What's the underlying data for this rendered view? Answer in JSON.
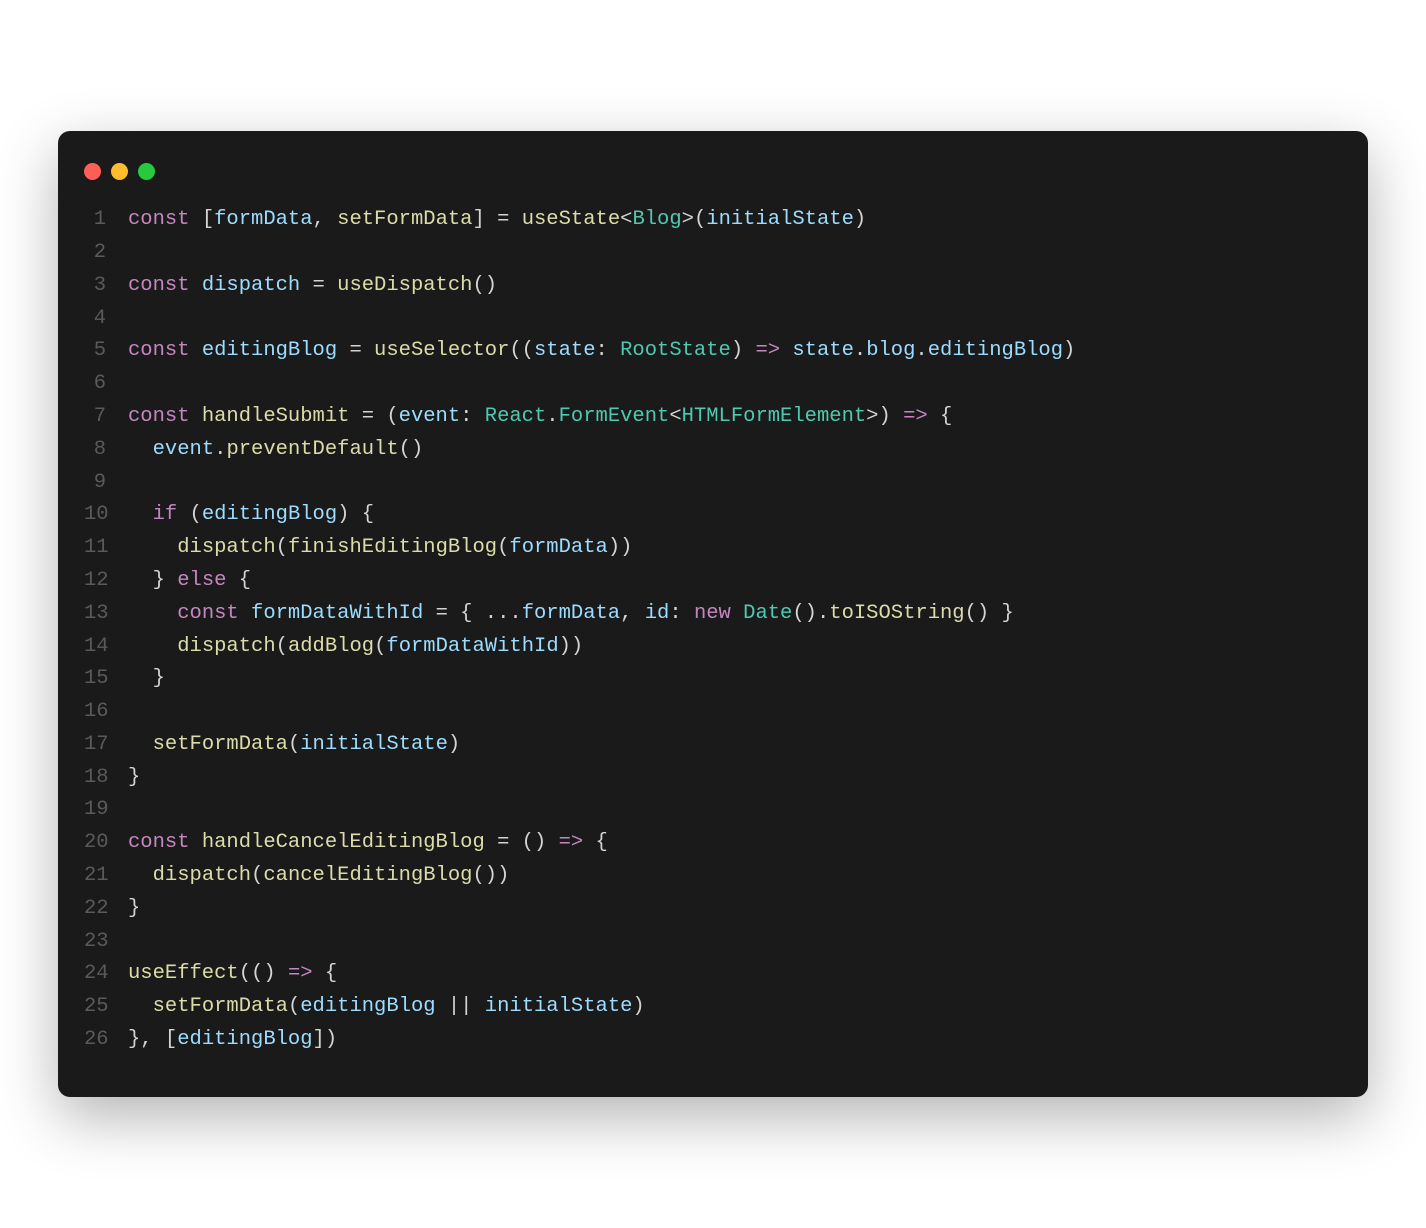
{
  "window": {
    "traffic_lights": [
      "red",
      "yellow",
      "green"
    ]
  },
  "code": {
    "lines": [
      {
        "n": 1,
        "tokens": [
          {
            "t": "const ",
            "c": "kw"
          },
          {
            "t": "[",
            "c": "punct"
          },
          {
            "t": "formData",
            "c": "id"
          },
          {
            "t": ", ",
            "c": "punct"
          },
          {
            "t": "setFormData",
            "c": "fn"
          },
          {
            "t": "] = ",
            "c": "punct"
          },
          {
            "t": "useState",
            "c": "fn"
          },
          {
            "t": "<",
            "c": "punct"
          },
          {
            "t": "Blog",
            "c": "type"
          },
          {
            "t": ">(",
            "c": "punct"
          },
          {
            "t": "initialState",
            "c": "id"
          },
          {
            "t": ")",
            "c": "punct"
          }
        ]
      },
      {
        "n": 2,
        "tokens": []
      },
      {
        "n": 3,
        "tokens": [
          {
            "t": "const ",
            "c": "kw"
          },
          {
            "t": "dispatch",
            "c": "id"
          },
          {
            "t": " = ",
            "c": "punct"
          },
          {
            "t": "useDispatch",
            "c": "fn"
          },
          {
            "t": "()",
            "c": "punct"
          }
        ]
      },
      {
        "n": 4,
        "tokens": []
      },
      {
        "n": 5,
        "tokens": [
          {
            "t": "const ",
            "c": "kw"
          },
          {
            "t": "editingBlog",
            "c": "id"
          },
          {
            "t": " = ",
            "c": "punct"
          },
          {
            "t": "useSelector",
            "c": "fn"
          },
          {
            "t": "((",
            "c": "punct"
          },
          {
            "t": "state",
            "c": "id"
          },
          {
            "t": ": ",
            "c": "punct"
          },
          {
            "t": "RootState",
            "c": "type"
          },
          {
            "t": ") ",
            "c": "punct"
          },
          {
            "t": "=>",
            "c": "kw"
          },
          {
            "t": " ",
            "c": "punct"
          },
          {
            "t": "state",
            "c": "id"
          },
          {
            "t": ".",
            "c": "punct"
          },
          {
            "t": "blog",
            "c": "prop"
          },
          {
            "t": ".",
            "c": "punct"
          },
          {
            "t": "editingBlog",
            "c": "prop"
          },
          {
            "t": ")",
            "c": "punct"
          }
        ]
      },
      {
        "n": 6,
        "tokens": []
      },
      {
        "n": 7,
        "tokens": [
          {
            "t": "const ",
            "c": "kw"
          },
          {
            "t": "handleSubmit",
            "c": "fn"
          },
          {
            "t": " = (",
            "c": "punct"
          },
          {
            "t": "event",
            "c": "id"
          },
          {
            "t": ": ",
            "c": "punct"
          },
          {
            "t": "React",
            "c": "type"
          },
          {
            "t": ".",
            "c": "punct"
          },
          {
            "t": "FormEvent",
            "c": "type"
          },
          {
            "t": "<",
            "c": "punct"
          },
          {
            "t": "HTMLFormElement",
            "c": "type"
          },
          {
            "t": ">) ",
            "c": "punct"
          },
          {
            "t": "=>",
            "c": "kw"
          },
          {
            "t": " {",
            "c": "punct"
          }
        ]
      },
      {
        "n": 8,
        "tokens": [
          {
            "t": "  ",
            "c": "punct"
          },
          {
            "t": "event",
            "c": "id"
          },
          {
            "t": ".",
            "c": "punct"
          },
          {
            "t": "preventDefault",
            "c": "fn"
          },
          {
            "t": "()",
            "c": "punct"
          }
        ]
      },
      {
        "n": 9,
        "tokens": []
      },
      {
        "n": 10,
        "tokens": [
          {
            "t": "  ",
            "c": "punct"
          },
          {
            "t": "if",
            "c": "kw"
          },
          {
            "t": " (",
            "c": "punct"
          },
          {
            "t": "editingBlog",
            "c": "id"
          },
          {
            "t": ") {",
            "c": "punct"
          }
        ]
      },
      {
        "n": 11,
        "tokens": [
          {
            "t": "    ",
            "c": "punct"
          },
          {
            "t": "dispatch",
            "c": "fn"
          },
          {
            "t": "(",
            "c": "punct"
          },
          {
            "t": "finishEditingBlog",
            "c": "fn"
          },
          {
            "t": "(",
            "c": "punct"
          },
          {
            "t": "formData",
            "c": "id"
          },
          {
            "t": "))",
            "c": "punct"
          }
        ]
      },
      {
        "n": 12,
        "tokens": [
          {
            "t": "  } ",
            "c": "punct"
          },
          {
            "t": "else",
            "c": "kw"
          },
          {
            "t": " {",
            "c": "punct"
          }
        ]
      },
      {
        "n": 13,
        "tokens": [
          {
            "t": "    ",
            "c": "punct"
          },
          {
            "t": "const ",
            "c": "kw"
          },
          {
            "t": "formDataWithId",
            "c": "id"
          },
          {
            "t": " = { ...",
            "c": "punct"
          },
          {
            "t": "formData",
            "c": "id"
          },
          {
            "t": ", ",
            "c": "punct"
          },
          {
            "t": "id",
            "c": "prop"
          },
          {
            "t": ": ",
            "c": "punct"
          },
          {
            "t": "new ",
            "c": "kw"
          },
          {
            "t": "Date",
            "c": "type"
          },
          {
            "t": "().",
            "c": "punct"
          },
          {
            "t": "toISOString",
            "c": "fn"
          },
          {
            "t": "() }",
            "c": "punct"
          }
        ]
      },
      {
        "n": 14,
        "tokens": [
          {
            "t": "    ",
            "c": "punct"
          },
          {
            "t": "dispatch",
            "c": "fn"
          },
          {
            "t": "(",
            "c": "punct"
          },
          {
            "t": "addBlog",
            "c": "fn"
          },
          {
            "t": "(",
            "c": "punct"
          },
          {
            "t": "formDataWithId",
            "c": "id"
          },
          {
            "t": "))",
            "c": "punct"
          }
        ]
      },
      {
        "n": 15,
        "tokens": [
          {
            "t": "  }",
            "c": "punct"
          }
        ]
      },
      {
        "n": 16,
        "tokens": []
      },
      {
        "n": 17,
        "tokens": [
          {
            "t": "  ",
            "c": "punct"
          },
          {
            "t": "setFormData",
            "c": "fn"
          },
          {
            "t": "(",
            "c": "punct"
          },
          {
            "t": "initialState",
            "c": "id"
          },
          {
            "t": ")",
            "c": "punct"
          }
        ]
      },
      {
        "n": 18,
        "tokens": [
          {
            "t": "}",
            "c": "punct"
          }
        ]
      },
      {
        "n": 19,
        "tokens": []
      },
      {
        "n": 20,
        "tokens": [
          {
            "t": "const ",
            "c": "kw"
          },
          {
            "t": "handleCancelEditingBlog",
            "c": "fn"
          },
          {
            "t": " = () ",
            "c": "punct"
          },
          {
            "t": "=>",
            "c": "kw"
          },
          {
            "t": " {",
            "c": "punct"
          }
        ]
      },
      {
        "n": 21,
        "tokens": [
          {
            "t": "  ",
            "c": "punct"
          },
          {
            "t": "dispatch",
            "c": "fn"
          },
          {
            "t": "(",
            "c": "punct"
          },
          {
            "t": "cancelEditingBlog",
            "c": "fn"
          },
          {
            "t": "())",
            "c": "punct"
          }
        ]
      },
      {
        "n": 22,
        "tokens": [
          {
            "t": "}",
            "c": "punct"
          }
        ]
      },
      {
        "n": 23,
        "tokens": []
      },
      {
        "n": 24,
        "tokens": [
          {
            "t": "useEffect",
            "c": "fn"
          },
          {
            "t": "(() ",
            "c": "punct"
          },
          {
            "t": "=>",
            "c": "kw"
          },
          {
            "t": " {",
            "c": "punct"
          }
        ]
      },
      {
        "n": 25,
        "tokens": [
          {
            "t": "  ",
            "c": "punct"
          },
          {
            "t": "setFormData",
            "c": "fn"
          },
          {
            "t": "(",
            "c": "punct"
          },
          {
            "t": "editingBlog",
            "c": "id"
          },
          {
            "t": " || ",
            "c": "op"
          },
          {
            "t": "initialState",
            "c": "id"
          },
          {
            "t": ")",
            "c": "punct"
          }
        ]
      },
      {
        "n": 26,
        "tokens": [
          {
            "t": "}, [",
            "c": "punct"
          },
          {
            "t": "editingBlog",
            "c": "id"
          },
          {
            "t": "])",
            "c": "punct"
          }
        ]
      }
    ]
  }
}
